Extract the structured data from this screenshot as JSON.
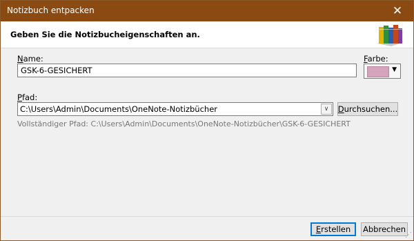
{
  "window": {
    "title": "Notizbuch entpacken",
    "close_glyph": "✕"
  },
  "header": {
    "instruction": "Geben Sie die Notizbucheigenschaften an.",
    "icon": "notebooks-icon"
  },
  "name": {
    "label_accel": "N",
    "label_rest": "ame:",
    "value": "GSK-6-GESICHERT"
  },
  "color": {
    "label_accel": "F",
    "label_rest": "arbe:",
    "selected_color": "#d6a3bc"
  },
  "path": {
    "label_accel": "P",
    "label_rest": "fad:",
    "value": "C:\\Users\\Admin\\Documents\\OneNote-Notizbücher",
    "browse_accel": "D",
    "browse_rest": "urchsuchen...",
    "full_path_text": "Vollständiger Pfad: C:\\Users\\Admin\\Documents\\OneNote-Notizbücher\\GSK-6-GESICHERT"
  },
  "buttons": {
    "create_accel": "E",
    "create_rest": "rstellen",
    "cancel": "Abbrechen"
  },
  "colors": {
    "titlebar": "#8b4a12",
    "focus_accent": "#0078d7"
  }
}
